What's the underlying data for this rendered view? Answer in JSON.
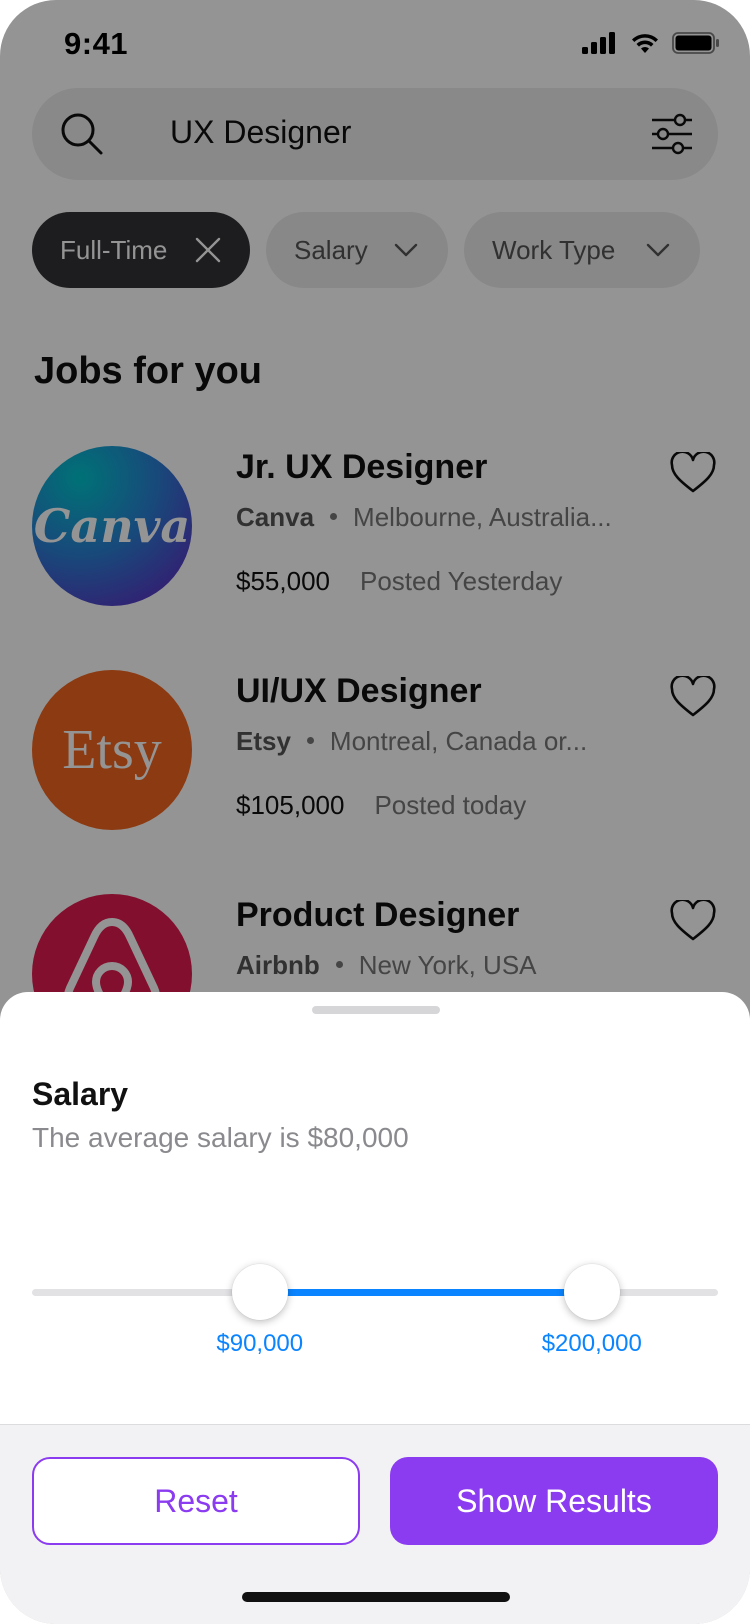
{
  "status_bar": {
    "time": "9:41"
  },
  "search": {
    "query": "UX Designer"
  },
  "filters": {
    "chips": [
      {
        "label": "Full-Time",
        "active": true
      },
      {
        "label": "Salary",
        "active": false
      },
      {
        "label": "Work Type",
        "active": false
      }
    ]
  },
  "section_title": "Jobs for you",
  "jobs": [
    {
      "title": "Jr. UX Designer",
      "company": "Canva",
      "location": "Melbourne, Australia...",
      "salary": "$55,000",
      "posted": "Posted Yesterday",
      "logo_text": "Canva"
    },
    {
      "title": "UI/UX Designer",
      "company": "Etsy",
      "location": "Montreal, Canada or...",
      "salary": "$105,000",
      "posted": "Posted today",
      "logo_text": "Etsy"
    },
    {
      "title": "Product Designer",
      "company": "Airbnb",
      "location": "New York, USA"
    }
  ],
  "sheet": {
    "title": "Salary",
    "subtitle": "The average salary is $80,000",
    "range": {
      "min_label": "$90,000",
      "max_label": "$200,000",
      "low_fraction": 0.332,
      "high_fraction": 0.816
    },
    "reset_label": "Reset",
    "show_results_label": "Show Results"
  },
  "colors": {
    "accent": "#8b3bf0",
    "slider": "#0a84ff"
  }
}
